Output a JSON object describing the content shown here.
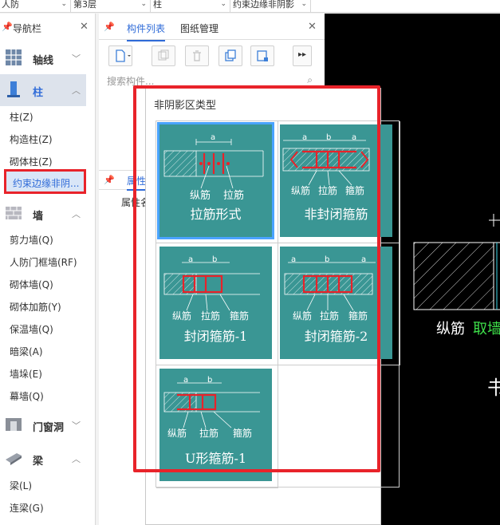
{
  "topbar": {
    "dropdowns": [
      "人防",
      "第3层",
      "柱",
      "约束边缘非阴影"
    ]
  },
  "nav": {
    "title": "导航栏",
    "categories": {
      "axis": "轴线",
      "column": "柱",
      "wall": "墙",
      "door": "门窗洞",
      "beam": "梁"
    },
    "column_items": [
      "柱(Z)",
      "构造柱(Z)",
      "砌体柱(Z)",
      "约束边缘非阴..."
    ],
    "wall_items": [
      "剪力墙(Q)",
      "人防门框墙(RF)",
      "砌体墙(Q)",
      "砌体加筋(Y)",
      "保温墙(Q)",
      "暗梁(A)",
      "墙垛(E)",
      "幕墙(Q)"
    ],
    "beam_items": [
      "梁(L)",
      "连梁(G)"
    ]
  },
  "comp": {
    "tab_list": "构件列表",
    "tab_drawing": "图纸管理",
    "search_placeholder": "搜索构件...",
    "prop_tab": "属性",
    "prop_col": "属性名"
  },
  "popup": {
    "title": "非阴影区类型",
    "cards": [
      {
        "name": "拉筋形式",
        "labels": [
          "纵筋",
          "拉筋"
        ],
        "dims": [
          "a"
        ],
        "selected": true
      },
      {
        "name": "非封闭箍筋",
        "labels": [
          "纵筋",
          "拉筋",
          "箍筋"
        ],
        "dims": [
          "a",
          "b",
          "a"
        ]
      },
      {
        "name": "封闭箍筋-1",
        "labels": [
          "纵筋",
          "拉筋",
          "箍筋"
        ],
        "dims": [
          "a",
          "b"
        ]
      },
      {
        "name": "封闭箍筋-2",
        "labels": [
          "纵筋",
          "拉筋",
          "箍筋"
        ],
        "dims": [
          "a",
          "b",
          "a"
        ]
      },
      {
        "name": "U形箍筋-1",
        "labels": [
          "纵筋",
          "拉筋",
          "箍筋"
        ],
        "dims": [
          "a",
          "b"
        ]
      }
    ]
  },
  "preview": {
    "label1": "纵筋",
    "label2": "取墙",
    "label3": "书"
  },
  "colors": {
    "accent": "#2f6bd8",
    "highlight": "#e8232a",
    "card": "#3a9694",
    "rebar": "#e8232a"
  }
}
